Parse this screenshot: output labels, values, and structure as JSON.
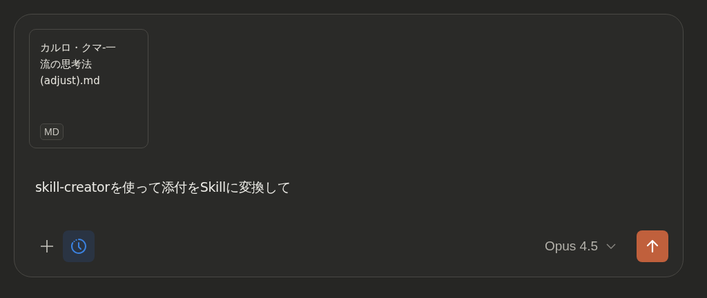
{
  "attachment": {
    "name_lines": [
      "カルロ・クマ-一",
      "流の思考法",
      "(adjust).md"
    ],
    "badge": "MD"
  },
  "message": "skill-creatorを使って添付をSkillに変換して",
  "toolbar": {
    "extended_thinking": {
      "on": true
    }
  },
  "model": {
    "label": "Opus 4.5"
  }
}
